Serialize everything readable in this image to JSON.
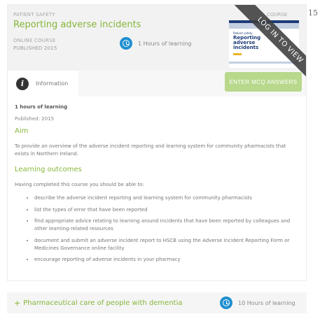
{
  "page_number": "15",
  "course": {
    "category": "PATIENT SAFETY",
    "title": "Reporting adverse incidents",
    "type": "ONLINE COURSE",
    "published": "PUBLISHED 2015",
    "hours": "1 Hours of learning",
    "right_label": "COURSE",
    "ribbon": "LOG IN TO VIEW",
    "thumbnail": {
      "small_text": "Patient safety",
      "title": "Reporting adverse incidents"
    }
  },
  "tabs": {
    "information": "Information",
    "mcq_button": "ENTER MCQ ANSWERS"
  },
  "details": {
    "hours_bold": "1 hours of learning",
    "published": "Published: 2015",
    "aim_heading": "Aim",
    "aim_text": "To provide an overview of the adverse incident reporting and learning system for community pharmacists that exists in Northern Ireland.",
    "outcomes_heading": "Learning outcomes",
    "outcomes_intro": "Having completed this course you should be able to:",
    "outcomes": [
      "describe the adverse incident reporting and learning system for community pharmacists",
      "list the types of error that have been reported",
      "find appropriate advice relating to learning around incidents that have been reported by colleagues and other learning-related resources",
      "document and submit an adverse incident report to HSCB using the Adverse Incident Reporting Form or Medicines Governance online facility",
      "encourage reporting of adverse incidents in your pharmacy"
    ]
  },
  "next_course": {
    "plus": "+",
    "title": "Pharmaceutical care of people with dementia",
    "hours": "10 Hours of learning"
  },
  "colors": {
    "accent_green": "#86b63a",
    "button_green": "#b8d88c",
    "clock_blue": "#1f8fd0",
    "ribbon_gray": "#3c3c3c"
  },
  "icons": [
    "clock-icon",
    "info-icon",
    "plus-icon"
  ]
}
